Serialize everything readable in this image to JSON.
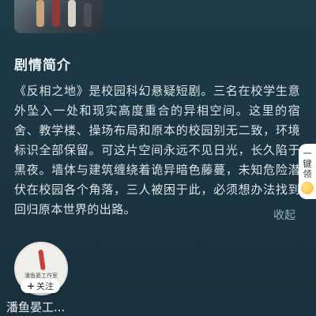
{
  "synopsis_section": {
    "title": "剧情简介",
    "text": "《反相之地》是校园科幻悬疑短剧。三名在校学生意外坠入一处和现实高度重合的异相空间。这里的宿舍、教学楼、操场布局和原本的校园别无二致，环境标识全部保留。可这片空间永远不见日光，长久陷于黑夜。墙体与建筑缠绕着诡异暗色藤蔓，未知危险潜伏在校园各个角落，三人被困于此，必须想办法找到回归原本世界的出路。",
    "collapse_label": "收起"
  },
  "claim_widget": {
    "line1": "一",
    "line2": "键",
    "line3": "领"
  },
  "studio": {
    "avatar_text": "潘鱼晏工作室",
    "follow_label": "关注",
    "name": "潘鱼晏工..."
  },
  "icons": {
    "poster": "drama-poster-thumbnail",
    "claim_coin": "gold-coin-icon",
    "plus": "plus-icon"
  }
}
